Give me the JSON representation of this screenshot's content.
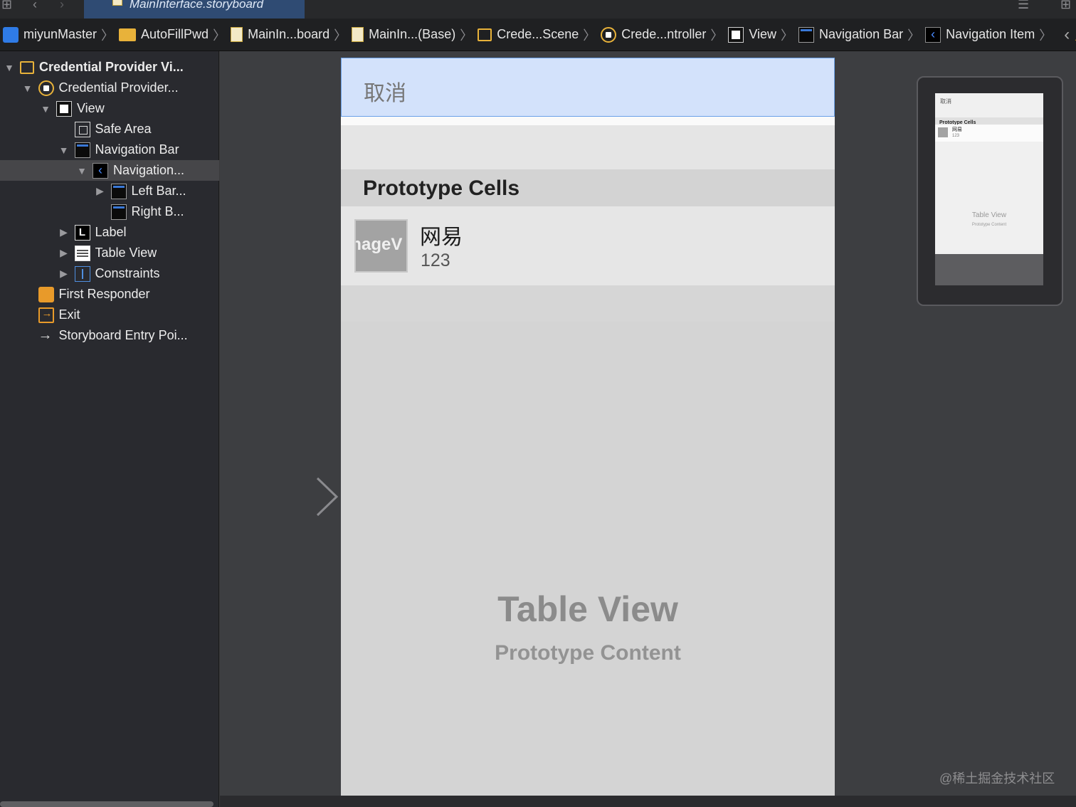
{
  "tabbar": {
    "active_tab": "MainInterface.storyboard"
  },
  "breadcrumb": {
    "items": [
      {
        "label": "miyunMaster",
        "icon": "project-icon"
      },
      {
        "label": "AutoFillPwd",
        "icon": "folder-icon"
      },
      {
        "label": "MainIn...board",
        "icon": "storyboard-icon"
      },
      {
        "label": "MainIn...(Base)",
        "icon": "storyboard-icon"
      },
      {
        "label": "Crede...Scene",
        "icon": "scene-icon"
      },
      {
        "label": "Crede...ntroller",
        "icon": "view-controller-icon"
      },
      {
        "label": "View",
        "icon": "view-icon"
      },
      {
        "label": "Navigation Bar",
        "icon": "navigation-bar-icon"
      },
      {
        "label": "Navigation Item",
        "icon": "navigation-item-icon"
      }
    ]
  },
  "outline": {
    "items": [
      {
        "label": "Credential Provider Vi...",
        "level": 0,
        "expanded": true,
        "icon": "scene-icon",
        "bold": true
      },
      {
        "label": "Credential Provider...",
        "level": 1,
        "expanded": true,
        "icon": "view-controller-icon"
      },
      {
        "label": "View",
        "level": 2,
        "expanded": true,
        "icon": "view-icon"
      },
      {
        "label": "Safe Area",
        "level": 3,
        "icon": "safe-area-icon"
      },
      {
        "label": "Navigation Bar",
        "level": 3,
        "expanded": true,
        "icon": "navigation-bar-icon"
      },
      {
        "label": "Navigation...",
        "level": 4,
        "expanded": true,
        "icon": "navigation-item-icon",
        "selected": true
      },
      {
        "label": "Left Bar...",
        "level": 5,
        "expanded": false,
        "icon": "bar-button-icon"
      },
      {
        "label": "Right B...",
        "level": 5,
        "icon": "bar-button-icon"
      },
      {
        "label": "Label",
        "level": 3,
        "expanded": false,
        "icon": "label-icon"
      },
      {
        "label": "Table View",
        "level": 3,
        "expanded": false,
        "icon": "table-view-icon"
      },
      {
        "label": "Constraints",
        "level": 3,
        "expanded": false,
        "icon": "constraints-icon"
      },
      {
        "label": "First Responder",
        "level": 1,
        "icon": "first-responder-icon"
      },
      {
        "label": "Exit",
        "level": 1,
        "icon": "exit-icon"
      },
      {
        "label": "Storyboard Entry Poi...",
        "level": 1,
        "icon": "entry-point-icon"
      }
    ]
  },
  "device": {
    "nav_cancel": "取消",
    "section_header": "Prototype Cells",
    "cell": {
      "image_placeholder": "ImageV",
      "title": "网易",
      "subtitle": "123"
    },
    "table_placeholder_title": "Table View",
    "table_placeholder_subtitle": "Prototype Content"
  },
  "minimap": {
    "cancel": "取消",
    "section": "Prototype Cells",
    "cell_title": "网易",
    "cell_sub": "123",
    "tv_title": "Table View",
    "tv_sub": "Prototype Content"
  },
  "watermark": "@稀土掘金技术社区",
  "colors": {
    "selection": "#464649",
    "nav_bar_fill": "#d3e2fb",
    "nav_bar_border": "#6aa0e8",
    "active_tab": "#2f4b73"
  }
}
